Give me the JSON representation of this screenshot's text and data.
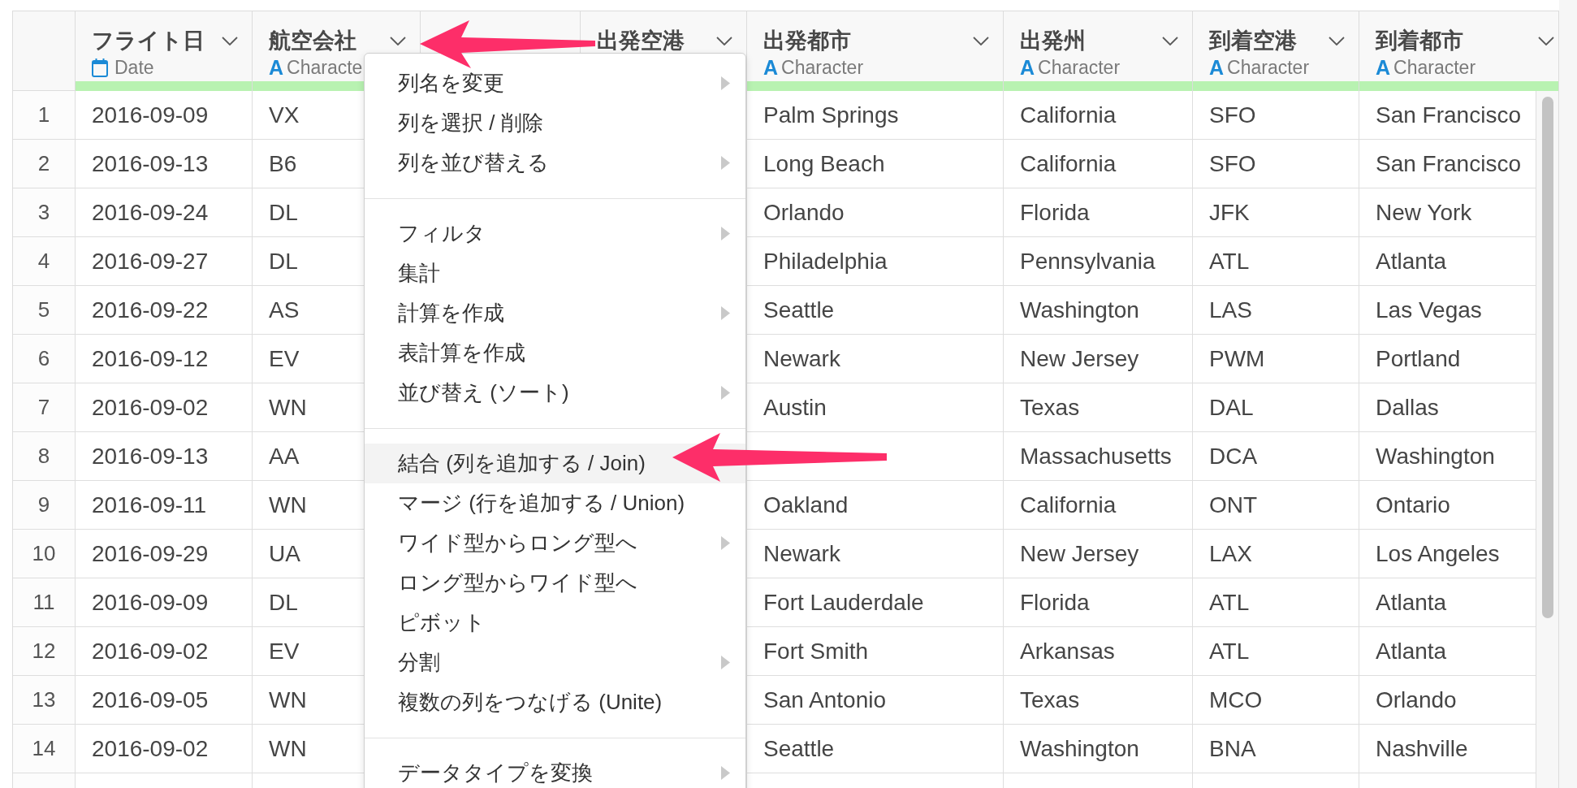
{
  "table": {
    "columns": [
      {
        "title": "フライト日",
        "dropdown": true,
        "type": {
          "kind": "date",
          "label": "Date"
        },
        "level": 1
      },
      {
        "title": "航空会社",
        "dropdown": true,
        "type": {
          "kind": "character",
          "glyph": "A",
          "label": "Characte"
        },
        "level": 1
      },
      {
        "dropdown": false
      },
      {
        "title": "出発空港",
        "dropdown": true
      },
      {
        "title": "出発都市",
        "dropdown": true,
        "type": {
          "kind": "character",
          "glyph": "A",
          "label": "Character"
        },
        "level": 1
      },
      {
        "title": "出発州",
        "dropdown": true,
        "type": {
          "kind": "character",
          "glyph": "A",
          "label": "Character"
        },
        "level": 1
      },
      {
        "title": "到着空港",
        "dropdown": true,
        "type": {
          "kind": "character",
          "glyph": "A",
          "label": "Character"
        },
        "level": 1
      },
      {
        "title": "到着都市",
        "dropdown": true,
        "type": {
          "kind": "character",
          "glyph": "A",
          "label": "Character"
        },
        "level": 1
      }
    ],
    "rows": [
      {
        "number": "1",
        "flight_date": "2016-09-09",
        "airline": "VX",
        "departure_city": "Palm Springs",
        "departure_state": "California",
        "arrival_airport": "SFO",
        "arrival_city": "San Francisco"
      },
      {
        "number": "2",
        "flight_date": "2016-09-13",
        "airline": "B6",
        "departure_city": "Long Beach",
        "departure_state": "California",
        "arrival_airport": "SFO",
        "arrival_city": "San Francisco"
      },
      {
        "number": "3",
        "flight_date": "2016-09-24",
        "airline": "DL",
        "departure_city": "Orlando",
        "departure_state": "Florida",
        "arrival_airport": "JFK",
        "arrival_city": "New York"
      },
      {
        "number": "4",
        "flight_date": "2016-09-27",
        "airline": "DL",
        "departure_city": "Philadelphia",
        "departure_state": "Pennsylvania",
        "arrival_airport": "ATL",
        "arrival_city": "Atlanta"
      },
      {
        "number": "5",
        "flight_date": "2016-09-22",
        "airline": "AS",
        "departure_city": "Seattle",
        "departure_state": "Washington",
        "arrival_airport": "LAS",
        "arrival_city": "Las Vegas"
      },
      {
        "number": "6",
        "flight_date": "2016-09-12",
        "airline": "EV",
        "departure_city": "Newark",
        "departure_state": "New Jersey",
        "arrival_airport": "PWM",
        "arrival_city": "Portland"
      },
      {
        "number": "7",
        "flight_date": "2016-09-02",
        "airline": "WN",
        "departure_city": "Austin",
        "departure_state": "Texas",
        "arrival_airport": "DAL",
        "arrival_city": "Dallas"
      },
      {
        "number": "8",
        "flight_date": "2016-09-13",
        "airline": "AA",
        "departure_state": "Massachusetts",
        "arrival_airport": "DCA",
        "arrival_city": "Washington"
      },
      {
        "number": "9",
        "flight_date": "2016-09-11",
        "airline": "WN",
        "departure_city": "Oakland",
        "departure_state": "California",
        "arrival_airport": "ONT",
        "arrival_city": "Ontario"
      },
      {
        "number": "10",
        "flight_date": "2016-09-29",
        "airline": "UA",
        "departure_city": "Newark",
        "departure_state": "New Jersey",
        "arrival_airport": "LAX",
        "arrival_city": "Los Angeles"
      },
      {
        "number": "11",
        "flight_date": "2016-09-09",
        "airline": "DL",
        "departure_city": "Fort Lauderdale",
        "departure_state": "Florida",
        "arrival_airport": "ATL",
        "arrival_city": "Atlanta"
      },
      {
        "number": "12",
        "flight_date": "2016-09-02",
        "airline": "EV",
        "departure_city": "Fort Smith",
        "departure_state": "Arkansas",
        "arrival_airport": "ATL",
        "arrival_city": "Atlanta"
      },
      {
        "number": "13",
        "flight_date": "2016-09-05",
        "airline": "WN",
        "departure_city": "San Antonio",
        "departure_state": "Texas",
        "arrival_airport": "MCO",
        "arrival_city": "Orlando"
      },
      {
        "number": "14",
        "flight_date": "2016-09-02",
        "airline": "WN",
        "departure_city": "Seattle",
        "departure_state": "Washington",
        "arrival_airport": "BNA",
        "arrival_city": "Nashville"
      }
    ]
  },
  "column_menu": {
    "sections": [
      {
        "items": [
          {
            "label": "列名を変更",
            "submenu": true,
            "selected": false
          },
          {
            "label": "列を選択 / 削除",
            "submenu": false,
            "selected": false
          },
          {
            "label": "列を並び替える",
            "submenu": true,
            "selected": false
          }
        ]
      },
      {
        "items": [
          {
            "label": "フィルタ",
            "submenu": true,
            "selected": false
          },
          {
            "label": "集計",
            "submenu": false,
            "selected": false
          },
          {
            "label": "計算を作成",
            "submenu": true,
            "selected": false
          },
          {
            "label": "表計算を作成",
            "submenu": false,
            "selected": false
          },
          {
            "label": "並び替え (ソート)",
            "submenu": true,
            "selected": false
          }
        ]
      },
      {
        "items": [
          {
            "label": "結合 (列を追加する / Join)",
            "submenu": false,
            "selected": true
          },
          {
            "label": "マージ (行を追加する / Union)",
            "submenu": false,
            "selected": false
          },
          {
            "label": "ワイド型からロング型へ",
            "submenu": true,
            "selected": false
          },
          {
            "label": "ロング型からワイド型へ",
            "submenu": false,
            "selected": false
          },
          {
            "label": "ピボット",
            "submenu": false,
            "selected": false
          },
          {
            "label": "分割",
            "submenu": true,
            "selected": false
          },
          {
            "label": "複数の列をつなげる (Unite)",
            "submenu": false,
            "selected": false
          }
        ]
      },
      {
        "items": [
          {
            "label": "データタイプを変換",
            "submenu": true,
            "selected": false
          }
        ]
      }
    ]
  }
}
